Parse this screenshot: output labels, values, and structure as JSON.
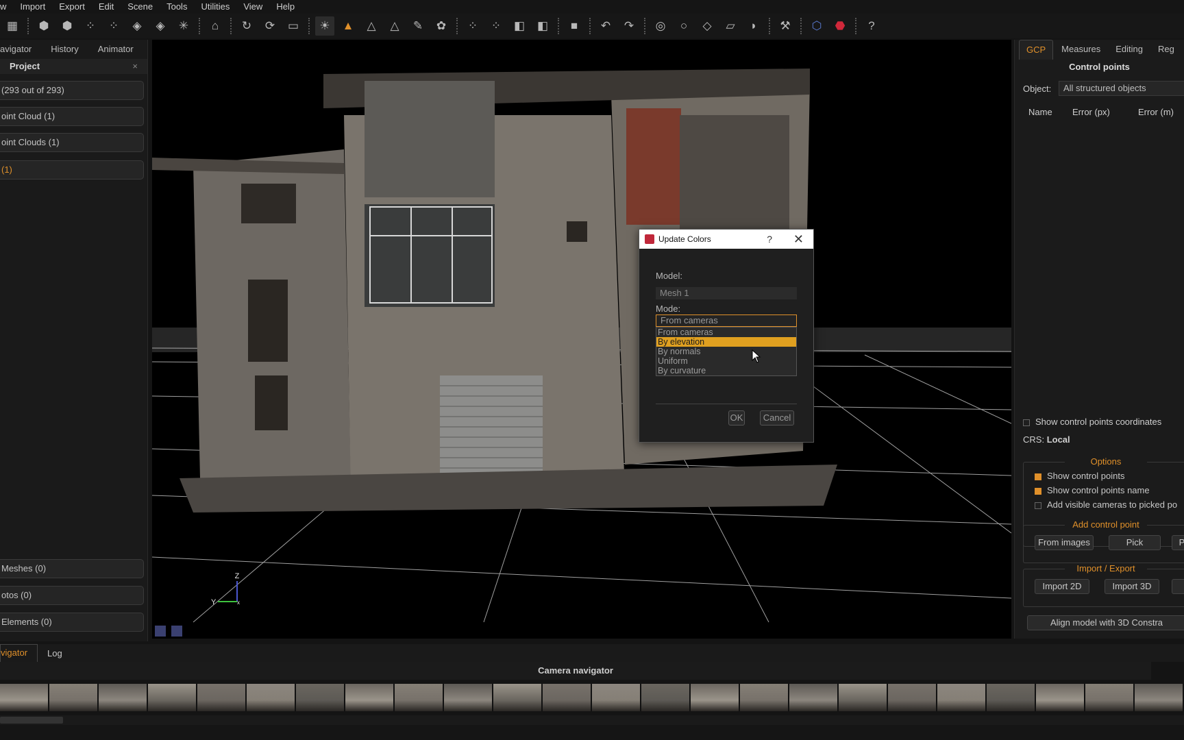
{
  "menu": [
    "w",
    "Import",
    "Export",
    "Edit",
    "Scene",
    "Tools",
    "Utilities",
    "View",
    "Help"
  ],
  "toolbar_icons": [
    "select-icon",
    "cube-icon",
    "cube-icon",
    "points-icon",
    "points-icon",
    "mesh-icon",
    "mesh-icon",
    "network-icon",
    "camera-icon",
    "rotate-icon",
    "orbit-icon",
    "wasd-icon",
    "light-icon",
    "color-icon",
    "triangle-icon",
    "triangle-icon",
    "brush-icon",
    "tree-icon",
    "points-icon",
    "points-icon",
    "box-icon",
    "box-icon",
    "square-icon",
    "undo-icon",
    "redo-icon",
    "lasso-icon",
    "circle-icon",
    "plane-icon",
    "ruler-icon",
    "magnet-icon",
    "tools-icon",
    "logo-icon",
    "logo-red-icon",
    "help-icon"
  ],
  "left": {
    "tabs": [
      "avigator",
      "History",
      "Animator"
    ],
    "header": "Project",
    "close": "×",
    "items": [
      " (293 out of 293)",
      "oint Cloud (1)",
      "oint Clouds (1)",
      "(1)"
    ],
    "bottom_items": [
      " Meshes (0)",
      "otos (0)",
      " Elements (0)"
    ]
  },
  "viewport": {
    "axis_z": "Z",
    "axis_y": "Y",
    "axis_x": "x"
  },
  "right": {
    "tabs": [
      "GCP",
      "Measures",
      "Editing",
      "Reg"
    ],
    "title": "Control points",
    "object_label": "Object:",
    "object_value": "All structured objects",
    "columns": [
      "Name",
      "Error (px)",
      "Error (m)"
    ],
    "show_coords": "Show control points coordinates",
    "crs_label": "CRS:",
    "crs_value": "Local",
    "options_title": "Options",
    "options": [
      "Show control points",
      "Show control points name",
      "Add visible cameras to picked po"
    ],
    "add_title": "Add control point",
    "add_buttons": [
      "From images",
      "Pick",
      "P"
    ],
    "ie_title": "Import / Export",
    "ie_buttons": [
      "Import 2D",
      "Import 3D",
      ""
    ],
    "align_button": "Align model with 3D Constra"
  },
  "dialog": {
    "title": "Update Colors",
    "help": "?",
    "close": "✕",
    "model_label": "Model:",
    "model_value": "Mesh 1",
    "mode_label": "Mode:",
    "mode_value": "From cameras",
    "options": [
      "From cameras",
      "By elevation",
      "By normals",
      "Uniform",
      "By curvature"
    ],
    "selected": 1,
    "ok": "OK",
    "cancel": "Cancel"
  },
  "bottom": {
    "tabs": [
      "vigator",
      "Log"
    ],
    "camera_title": "Camera navigator"
  },
  "colors": {
    "accent": "#e0902a",
    "selected_option": "#e0a020"
  }
}
